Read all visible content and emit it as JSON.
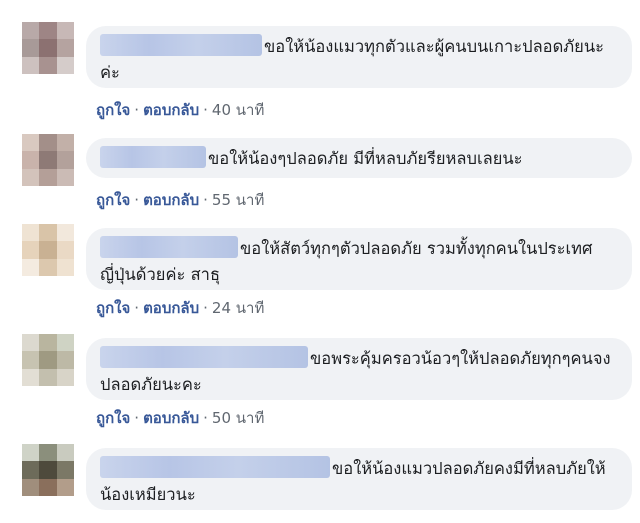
{
  "comments": [
    {
      "avatar_colors": [
        "#b8a9a8",
        "#9e8585",
        "#c7b8b6",
        "#a89a98",
        "#8c7171",
        "#b5a3a0",
        "#cdc1bf",
        "#a89290",
        "#d5ccca"
      ],
      "text": "ขอให้น้องแมวทุกตัวและผู้คนบนเกาะปลอดภัยนะค่ะ",
      "like_label": "ถูกใจ",
      "reply_label": "ตอบกลับ",
      "time": "40 นาที"
    },
    {
      "avatar_colors": [
        "#d9c9c0",
        "#a38f89",
        "#c2b0a8",
        "#c9b3ab",
        "#8e7a76",
        "#b3a19b",
        "#d3c3bb",
        "#b49f98",
        "#cbbbb5"
      ],
      "text": "ขอให้น้องๆปลอดภัย มีที่หลบภัยรียหลบเลยนะ",
      "like_label": "ถูกใจ",
      "reply_label": "ตอบกลับ",
      "time": "55 นาที"
    },
    {
      "avatar_colors": [
        "#efe3d3",
        "#d9c4a8",
        "#f2e8dc",
        "#e6d3bb",
        "#c9b193",
        "#ead9c5",
        "#f4ebe0",
        "#dcc8ae",
        "#efe2d1"
      ],
      "text": "ขอให้สัตว์ทุกๆตัวปลอดภัย รวมทั้งทุกคนในประเทศญี่ปุ่นด้วยค่ะ สาธุ",
      "like_label": "ถูกใจ",
      "reply_label": "ตอบกลับ",
      "time": "24 นาที"
    },
    {
      "avatar_colors": [
        "#dcd9cf",
        "#b9b59f",
        "#cfd3c4",
        "#c7c3b1",
        "#9f9a82",
        "#bdb9a6",
        "#e2ded4",
        "#c3bfae",
        "#d8d4c8"
      ],
      "text": "ขอพระคุ้มครอวน้อวๆให้ปลอดภัยทุกๆคนจงปลอดภัยนะคะ",
      "like_label": "ถูกใจ",
      "reply_label": "ตอบกลับ",
      "time": "50 นาที"
    },
    {
      "avatar_colors": [
        "#cfd3c7",
        "#8b8f7c",
        "#c9cbbf",
        "#6d6b5a",
        "#4e4a3c",
        "#7b7866",
        "#a08e7c",
        "#8a6f5c",
        "#b29d8a"
      ],
      "text": "ขอให้น้องแมวปลอดภัยคงมีที่หลบภัยให้น้องเหมียวนะ"
    }
  ]
}
